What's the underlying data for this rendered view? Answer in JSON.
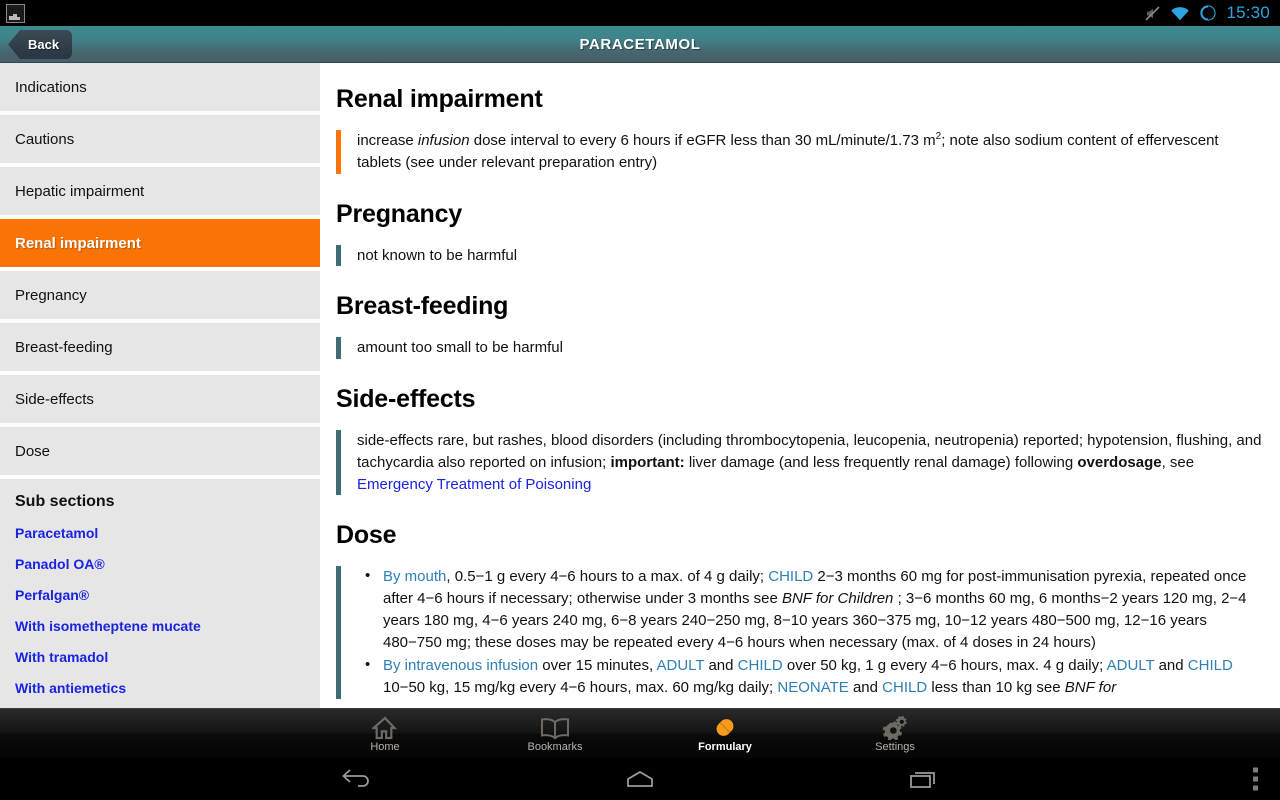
{
  "statusbar": {
    "app_icon": "image-notification-icon",
    "icons": [
      "mute-icon",
      "wifi-icon",
      "battery-icon"
    ],
    "clock": "15:30"
  },
  "titlebar": {
    "back_label": "Back",
    "title": "PARACETAMOL"
  },
  "sidebar": {
    "items": [
      {
        "label": "Indications",
        "active": false
      },
      {
        "label": "Cautions",
        "active": false
      },
      {
        "label": "Hepatic impairment",
        "active": false
      },
      {
        "label": "Renal impairment",
        "active": true
      },
      {
        "label": "Pregnancy",
        "active": false
      },
      {
        "label": "Breast-feeding",
        "active": false
      },
      {
        "label": "Side-effects",
        "active": false
      },
      {
        "label": "Dose",
        "active": false
      }
    ],
    "subsections": {
      "title": "Sub sections",
      "links": [
        "Paracetamol",
        "Panadol OA®",
        "Perfalgan®",
        "With isometheptene mucate",
        "With tramadol",
        "With antiemetics"
      ]
    }
  },
  "content": {
    "renal": {
      "heading": "Renal impairment",
      "text_1": "increase ",
      "text_italic": "infusion",
      "text_2": "  dose interval to every 6 hours if eGFR less than 30 mL/minute/1.73 m",
      "superscript": "2",
      "text_3": "; note also sodium content of effervescent tablets (see under relevant preparation entry)"
    },
    "pregnancy": {
      "heading": "Pregnancy",
      "text": "not known to be harmful"
    },
    "breastfeeding": {
      "heading": "Breast-feeding",
      "text": "amount too small to be harmful"
    },
    "side_effects": {
      "heading": "Side-effects",
      "text_1": "side-effects rare, but rashes, blood disorders (including thrombocytopenia, leucopenia, neutropenia) reported; hypotension, flushing, and tachycardia also reported on infusion; ",
      "important": "important:",
      "text_2": " liver damage (and less frequently renal damage) following ",
      "overdosage": "overdosage",
      "text_3": ", see ",
      "link": "Emergency Treatment of Poisoning"
    },
    "dose": {
      "heading": "Dose",
      "item1": {
        "route": "By mouth",
        "t1": ", 0.5−1 g every 4−6 hours to a max. of 4 g daily; ",
        "child1": "CHILD",
        "t2": " 2−3 months 60 mg for post-immunisation pyrexia, repeated once after 4−6 hours if necessary; otherwise under 3 months see ",
        "bnf": "BNF for Children",
        "t3": " ; 3−6 months 60 mg, 6 months−2 years 120 mg, 2−4 years 180 mg, 4−6 years 240 mg, 6−8 years 240−250 mg, 8−10 years 360−375 mg, 10−12 years 480−500 mg, 12−16 years 480−750 mg; these doses may be repeated every 4−6 hours when necessary (max. of 4 doses in 24 hours)"
      },
      "item2": {
        "route": "By intravenous infusion",
        "t1": " over 15 minutes, ",
        "adult1": "ADULT",
        "t2": " and ",
        "child1": "CHILD",
        "t3": " over 50 kg, 1 g every 4−6 hours, max. 4 g daily; ",
        "adult2": "ADULT",
        "t4": " and ",
        "child2": "CHILD",
        "t5": " 10−50 kg, 15 mg/kg every 4−6 hours, max. 60 mg/kg daily; ",
        "neonate": "NEONATE",
        "t6": " and ",
        "child3": "CHILD",
        "t7": " less than 10 kg see ",
        "bnf": "BNF for"
      }
    }
  },
  "tabbar": {
    "tabs": [
      {
        "label": "Home",
        "icon": "home-icon",
        "active": false
      },
      {
        "label": "Bookmarks",
        "icon": "book-icon",
        "active": false
      },
      {
        "label": "Formulary",
        "icon": "pill-icon",
        "active": true
      },
      {
        "label": "Settings",
        "icon": "gears-icon",
        "active": false
      }
    ]
  },
  "navbar": {
    "buttons": [
      "back-icon",
      "home-icon",
      "recents-icon"
    ],
    "overflow": "overflow-menu-icon"
  },
  "colors": {
    "accent_orange": "#f97306",
    "teal_bar": "#3f6b75",
    "link_blue": "#1a23e0",
    "link_teal": "#2f7fb5",
    "titlebar": "#3f838a"
  }
}
